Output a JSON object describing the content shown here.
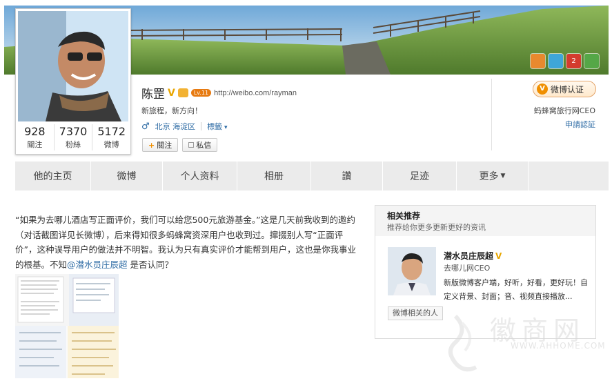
{
  "profile": {
    "name": "陈罡",
    "verified_mark": "V",
    "level": "Lv.11",
    "url": "http://weibo.com/rayman",
    "bio": "新旅程，新方向！",
    "gender_icon": "♂",
    "location": "北京 海淀区",
    "tags_label": "標籤",
    "stats": [
      {
        "num": "928",
        "label": "關注"
      },
      {
        "num": "7370",
        "label": "粉絲"
      },
      {
        "num": "5172",
        "label": "微博"
      }
    ],
    "follow_label": "關注",
    "message_label": "私信"
  },
  "cover_badges": [
    {
      "label": "",
      "color": "#e8892e"
    },
    {
      "label": "",
      "color": "#3fa6d8"
    },
    {
      "label": "2",
      "color": "#d43b2e"
    },
    {
      "label": "",
      "color": "#55a747"
    }
  ],
  "verification": {
    "button_label": "微博认证",
    "mark": "V",
    "description": "蚂蜂窝旅行网CEO",
    "apply_label": "申請認証"
  },
  "nav": {
    "tabs": [
      {
        "label": "他的主页"
      },
      {
        "label": "微博"
      },
      {
        "label": "个人资料"
      },
      {
        "label": "相册"
      },
      {
        "label": "讚"
      },
      {
        "label": "足迹"
      },
      {
        "label": "更多"
      }
    ]
  },
  "post": {
    "text_before": "“如果为去哪儿酒店写正面评价，我们可以给您500元旅游基金。”这是几天前我收到的邀约（对话截图详见长微博），后来得知很多蚂蜂窝资深用户也收到过。撺掇别人写“正面评价”，这种误导用户的做法并不明智。我认为只有真实评价才能帮到用户，这也是你我事业的根基。不知",
    "mention": "@潜水员庄辰超",
    "text_after": " 是否认同？"
  },
  "recommend": {
    "title": "相关推荐",
    "subtitle": "推荐给你更多更新更好的资讯",
    "person_name": "潜水员庄辰超",
    "verified_mark": "V",
    "person_role": "去哪儿网CEO",
    "person_desc": "新版微博客户端，好听，好看，更好玩！自定义背景、封面；音、视频直接播放...",
    "related_label": "微博相关的人"
  },
  "watermark": {
    "text": "徽商网",
    "url": "WWW.AHHOME.COM"
  }
}
